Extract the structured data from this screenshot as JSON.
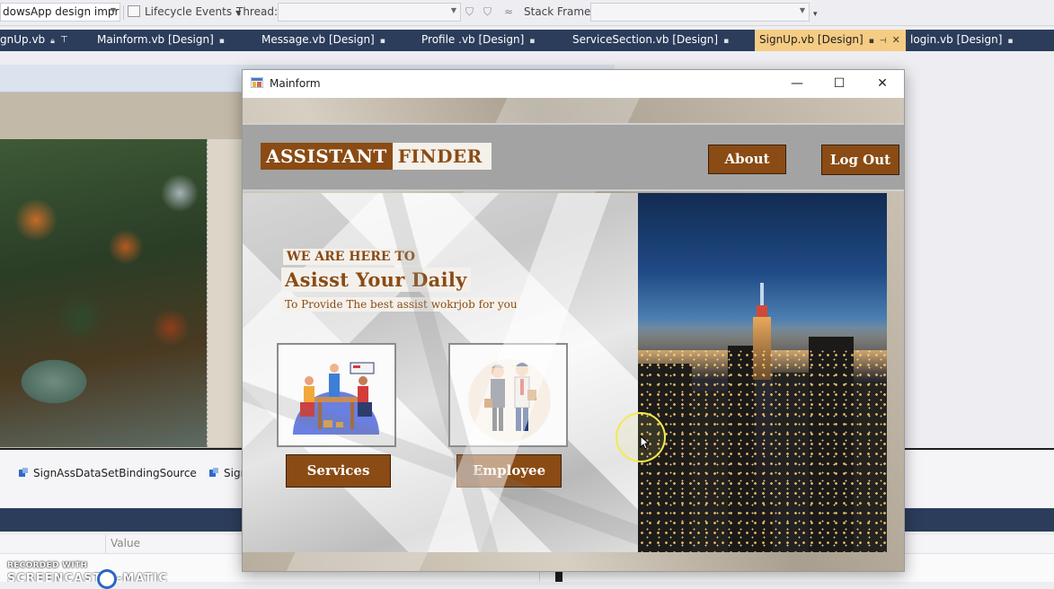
{
  "toolbar": {
    "project_combo": "dowsApp design impr",
    "lifecycle_label": "Lifecycle Events",
    "thread_label": "Thread:",
    "stack_frame_label": "Stack Frame:"
  },
  "tabs": [
    {
      "label": "gnUp.vb",
      "active": false
    },
    {
      "label": "Mainform.vb [Design]",
      "active": false
    },
    {
      "label": "Message.vb [Design]",
      "active": false
    },
    {
      "label": "Profile .vb [Design]",
      "active": false
    },
    {
      "label": "ServiceSection.vb [Design]",
      "active": false
    },
    {
      "label": "SignUp.vb [Design]",
      "active": true
    },
    {
      "label": "login.vb [Design]",
      "active": false
    }
  ],
  "tray": {
    "item1": "SignAssDataSetBindingSource",
    "item2": "Sign"
  },
  "properties": {
    "value_header": "Value"
  },
  "watermark": {
    "line1": "RECORDED WITH",
    "line2": "SCREENCAST-O-MATIC"
  },
  "window": {
    "title": "Mainform",
    "minimize": "—",
    "maximize": "☐",
    "close": "✕"
  },
  "app": {
    "logo_part1": "ASSISTANT",
    "logo_part2": "FINDER",
    "about_button": "About",
    "logout_button": "Log Out",
    "tagline_small": "WE ARE HERE TO",
    "tagline_big": "Asisst Your Daily",
    "tagline_sub": "To Provide The best assist wokrjob for you",
    "services_button": "Services",
    "employee_button": "Employee"
  },
  "colors": {
    "brand_brown": "#8a4b14",
    "tab_strip": "#2b3d5b",
    "active_tab": "#f5cc84"
  }
}
